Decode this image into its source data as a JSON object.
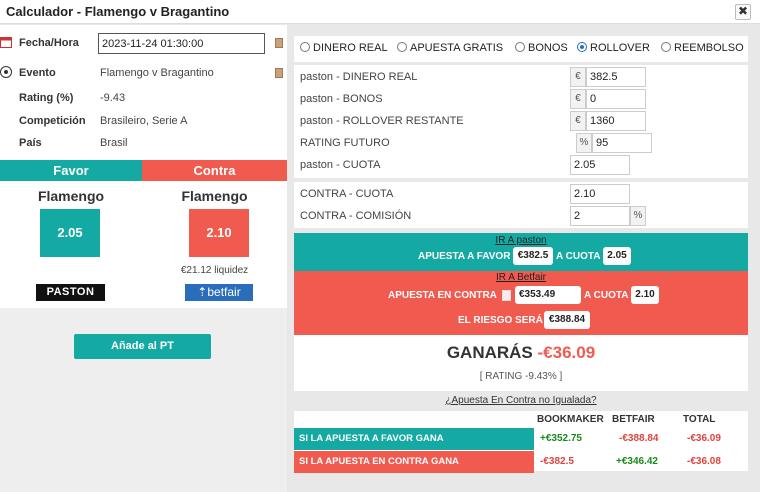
{
  "window": {
    "title": "Calculador - Flamengo v Bragantino",
    "close_label": "✖"
  },
  "event_info": {
    "date_label": "Fecha/Hora",
    "date_value": "2023-11-24 01:30:00",
    "event_label": "Evento",
    "event_value": "Flamengo v Bragantino",
    "rating_label": "Rating (%)",
    "rating_value": "-9.43",
    "competition_label": "Competición",
    "competition_value": "Brasileiro, Serie A",
    "country_label": "País",
    "country_value": "Brasil"
  },
  "favor": {
    "header": "Favor",
    "team": "Flamengo",
    "odd": "2.05",
    "bookmaker_logo": "PASTON"
  },
  "contra": {
    "header": "Contra",
    "team": "Flamengo",
    "odd": "2.10",
    "liquidity": "€21.12 liquidez",
    "exchange_logo": "⇡betfair"
  },
  "add_button": "Añade al PT",
  "offer_types": [
    {
      "label": "DINERO REAL",
      "selected": false
    },
    {
      "label": "APUESTA GRATIS",
      "selected": false
    },
    {
      "label": "BONOS",
      "selected": false
    },
    {
      "label": "ROLLOVER",
      "selected": true
    },
    {
      "label": "REEMBOLSO",
      "selected": false
    }
  ],
  "fields": {
    "real_money": {
      "label": "paston - DINERO REAL",
      "unit": "€",
      "value": "382.5"
    },
    "bonus": {
      "label": "paston - BONOS",
      "unit": "€",
      "value": "0"
    },
    "rollover": {
      "label": "paston - ROLLOVER RESTANTE",
      "unit": "€",
      "value": "1360"
    },
    "future_rating": {
      "label": "RATING FUTURO",
      "unit": "%",
      "value": "95"
    },
    "back_odds": {
      "label": "paston - CUOTA",
      "value": "2.05"
    },
    "lay_odds": {
      "label": "CONTRA - CUOTA",
      "value": "2.10"
    },
    "commission": {
      "label": "CONTRA - COMISIÓN",
      "unit": "%",
      "value": "2"
    }
  },
  "instructions": {
    "back_link": "IR A paston",
    "back_text": "APUESTA A FAVOR",
    "back_stake": "€382.5",
    "back_odds_text": "A CUOTA",
    "back_odds": "2.05",
    "lay_link": "IR A Betfair",
    "lay_text": "APUESTA EN CONTRA",
    "lay_stake": "€353.49",
    "lay_odds_text": "A CUOTA",
    "lay_odds": "2.10",
    "risk_text": "EL RIESGO SERÁ",
    "risk_value": "€388.84"
  },
  "result": {
    "label": "GANARÁS",
    "value": "-€36.09",
    "rating": "[ RATING -9.43% ]"
  },
  "unmatched_link": "¿Apuesta En Contra no Igualada?",
  "outcome_table": {
    "headers": [
      "BOOKMAKER",
      "BETFAIR",
      "TOTAL"
    ],
    "rows": [
      {
        "label": "SI LA APUESTA A FAVOR GANA",
        "bookmaker": "+€352.75",
        "betfair": "-€388.84",
        "total": "-€36.09"
      },
      {
        "label": "SI LA APUESTA EN CONTRA GANA",
        "bookmaker": "-€382.5",
        "betfair": "+€346.42",
        "total": "-€36.08"
      }
    ]
  },
  "colors": {
    "favor": "#15a9a3",
    "contra": "#f05a4f",
    "positive": "#1a8a1a",
    "negative": "#e0443a"
  }
}
